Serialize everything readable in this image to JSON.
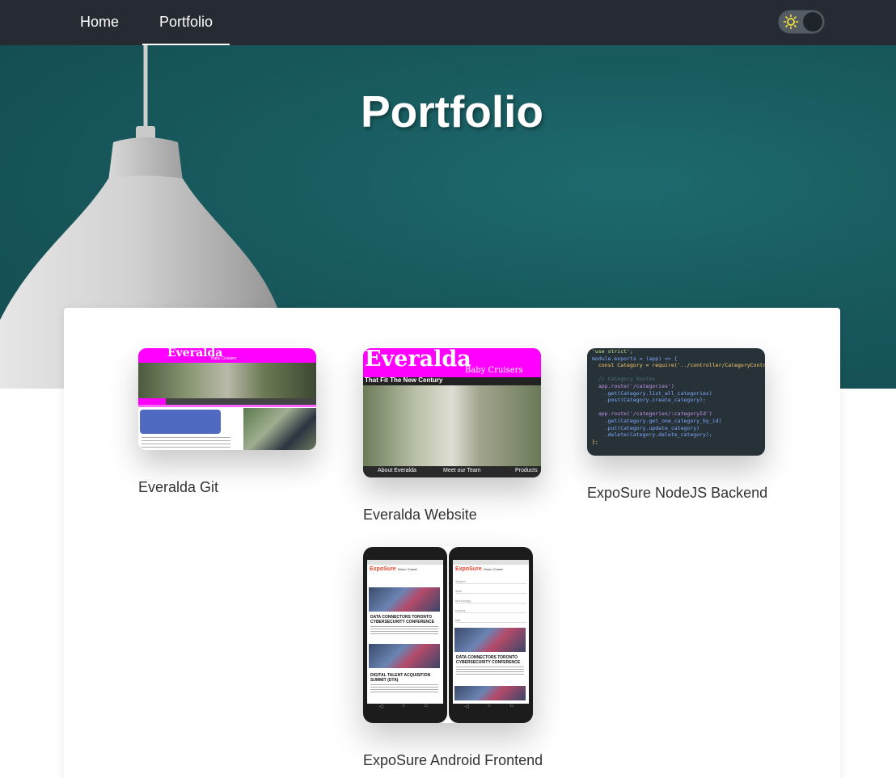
{
  "nav": {
    "items": [
      {
        "label": "Home"
      },
      {
        "label": "Portfolio"
      }
    ],
    "active": "Portfolio",
    "theme_toggle": {
      "state": "dark",
      "icon": "sun-icon"
    }
  },
  "hero": {
    "title": "Portfolio"
  },
  "projects": [
    {
      "caption": "Everalda Git",
      "thumb": {
        "title": "Everalda",
        "subtitle": "Baby Cruisers"
      }
    },
    {
      "caption": "Everalda Website",
      "thumb": {
        "title": "Everalda",
        "subtitle": "Baby Cruisers",
        "tagline": "That Fit The New Century",
        "nav": [
          "About Everalda",
          "Meet our Team",
          "Products"
        ]
      }
    },
    {
      "caption": "ExpoSure NodeJS Backend",
      "thumb": {
        "code": [
          "'use strict';",
          "module.exports = (app) => {",
          "  const Category = require('../controller/CategoryContr",
          "  // Category Routes",
          "  app.route('/categories')",
          "    .get(Category.list_all_categories)",
          "    .post(Category.create_category);",
          "  app.route('/categories/:categoryId')",
          "    .get(Category.get_one_category_by_id)",
          "    .put(Category.update_category)",
          "    .delete(Category.delete_category);",
          "};"
        ]
      }
    },
    {
      "caption": "ExpoSure Android Frontend",
      "thumb": {
        "app_name": "ExpoSure",
        "app_tag": "Vision Chase!",
        "event1": "DATA CONNECTORS TORONTO CYBERSECURITY CONFERENCE",
        "event2": "DIGITAL TALENT ACQUISITION SUMMIT (DTA)",
        "search_placeholder": "Search",
        "search_items": [
          "data",
          "technology",
          "conent",
          "fast"
        ]
      }
    }
  ],
  "colors": {
    "navbar": "#252a33",
    "hero": "#185a5e",
    "accent_magenta": "#ff00ff"
  }
}
